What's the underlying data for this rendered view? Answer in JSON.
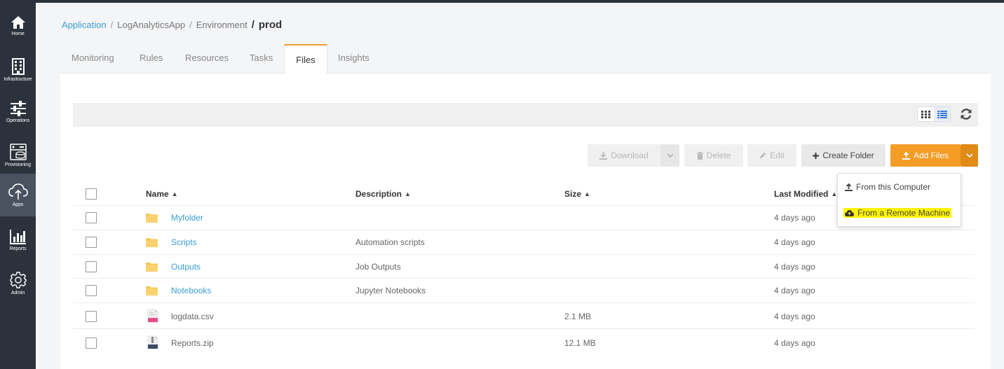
{
  "sidebar": {
    "items": [
      {
        "label": "Home",
        "icon": "home-icon"
      },
      {
        "label": "Infrastructure",
        "icon": "building-icon"
      },
      {
        "label": "Operations",
        "icon": "sliders-icon"
      },
      {
        "label": "Provisioning",
        "icon": "server-icon"
      },
      {
        "label": "Apps",
        "icon": "cloud-upload-icon",
        "active": true
      },
      {
        "label": "Reports",
        "icon": "bar-chart-icon"
      },
      {
        "label": "Admin",
        "icon": "gear-icon"
      }
    ]
  },
  "breadcrumb": {
    "items": [
      "Application",
      "LogAnalyticsApp",
      "Environment"
    ],
    "separator": "/",
    "current": "prod"
  },
  "tabs": [
    {
      "label": "Monitoring"
    },
    {
      "label": "Rules"
    },
    {
      "label": "Resources"
    },
    {
      "label": "Tasks"
    },
    {
      "label": "Files",
      "active": true
    },
    {
      "label": "Insights"
    }
  ],
  "toolbar": {
    "download": "Download",
    "delete": "Delete",
    "edit": "Edit",
    "create_folder": "Create Folder",
    "add_files": "Add Files"
  },
  "add_files_menu": {
    "items": [
      "From this Computer",
      "From a Remote Machine"
    ],
    "highlighted": "From a Remote Machine"
  },
  "table": {
    "columns": [
      "Name",
      "Description",
      "Size",
      "Last Modified"
    ],
    "rows": [
      {
        "name": "Myfolder",
        "type": "folder",
        "description": "",
        "size": "",
        "modified": "4 days ago"
      },
      {
        "name": "Scripts",
        "type": "folder",
        "description": "Automation scripts",
        "size": "",
        "modified": "4 days ago"
      },
      {
        "name": "Outputs",
        "type": "folder",
        "description": "Job Outputs",
        "size": "",
        "modified": "4 days ago"
      },
      {
        "name": "Notebooks",
        "type": "folder",
        "description": "Jupyter Notebooks",
        "size": "",
        "modified": "4 days ago"
      },
      {
        "name": "logdata.csv",
        "type": "csv",
        "description": "",
        "size": "2.1 MB",
        "modified": "4 days ago"
      },
      {
        "name": "Reports.zip",
        "type": "zip",
        "description": "",
        "size": "12.1 MB",
        "modified": "4 days ago"
      }
    ]
  },
  "colors": {
    "accent": "#f39c26",
    "link": "#3a9fd6",
    "sidebar": "#2c323c"
  }
}
